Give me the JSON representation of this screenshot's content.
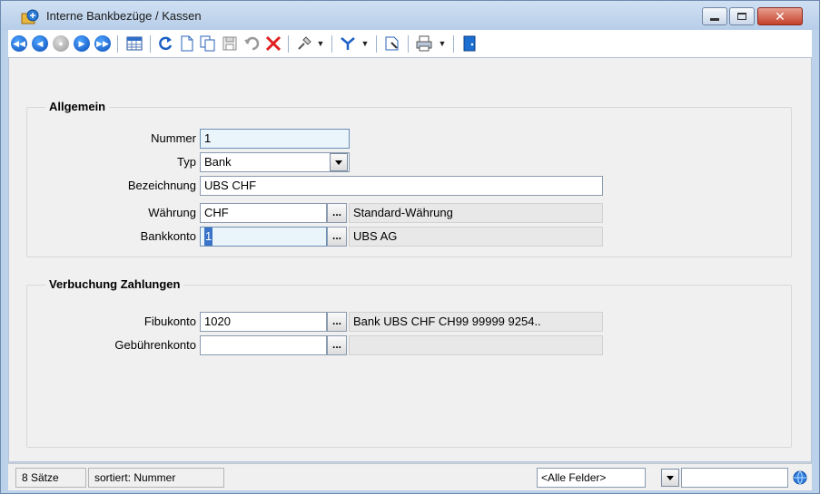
{
  "window": {
    "title": "Interne Bankbezüge / Kassen",
    "controls": {
      "minimize_icon": "minimize-icon",
      "maximize_icon": "maximize-icon",
      "close_icon": "close-icon"
    }
  },
  "toolbar": {
    "buttons": [
      "first-record-icon",
      "previous-record-icon",
      "neutral-record-icon",
      "next-record-icon",
      "last-record-icon",
      "table-view-icon",
      "refresh-icon",
      "new-record-icon",
      "copy-record-icon",
      "save-icon",
      "undo-icon",
      "delete-icon",
      "pin-icon",
      "filter-icon",
      "search-icon",
      "print-icon",
      "exit-icon"
    ]
  },
  "allgemein": {
    "title": "Allgemein",
    "nummer": {
      "label": "Nummer",
      "value": "1"
    },
    "typ": {
      "label": "Typ",
      "value": "Bank"
    },
    "bezeichnung": {
      "label": "Bezeichnung",
      "value": "UBS CHF"
    },
    "waehrung": {
      "label": "Währung",
      "value": "CHF",
      "button": "...",
      "description": "Standard-Währung"
    },
    "bankkonto": {
      "label": "Bankkonto",
      "value": "1",
      "button": "...",
      "description": "UBS AG"
    }
  },
  "verbuchung": {
    "title": "Verbuchung Zahlungen",
    "fibukonto": {
      "label": "Fibukonto",
      "value": "1020",
      "button": "...",
      "description": "Bank UBS CHF CH99 99999 9254.."
    },
    "gebuehrenkonto": {
      "label": "Gebührenkonto",
      "value": "",
      "button": "...",
      "description": ""
    }
  },
  "statusbar": {
    "count": "8 Sätze",
    "sort": "sortiert: Nummer",
    "field_filter": "<Alle Felder>",
    "search_value": ""
  },
  "colors": {
    "accent": "#0a4fb8",
    "titlebar": "#bcd1ea",
    "close": "#c4402a",
    "delete": "#e02020"
  }
}
